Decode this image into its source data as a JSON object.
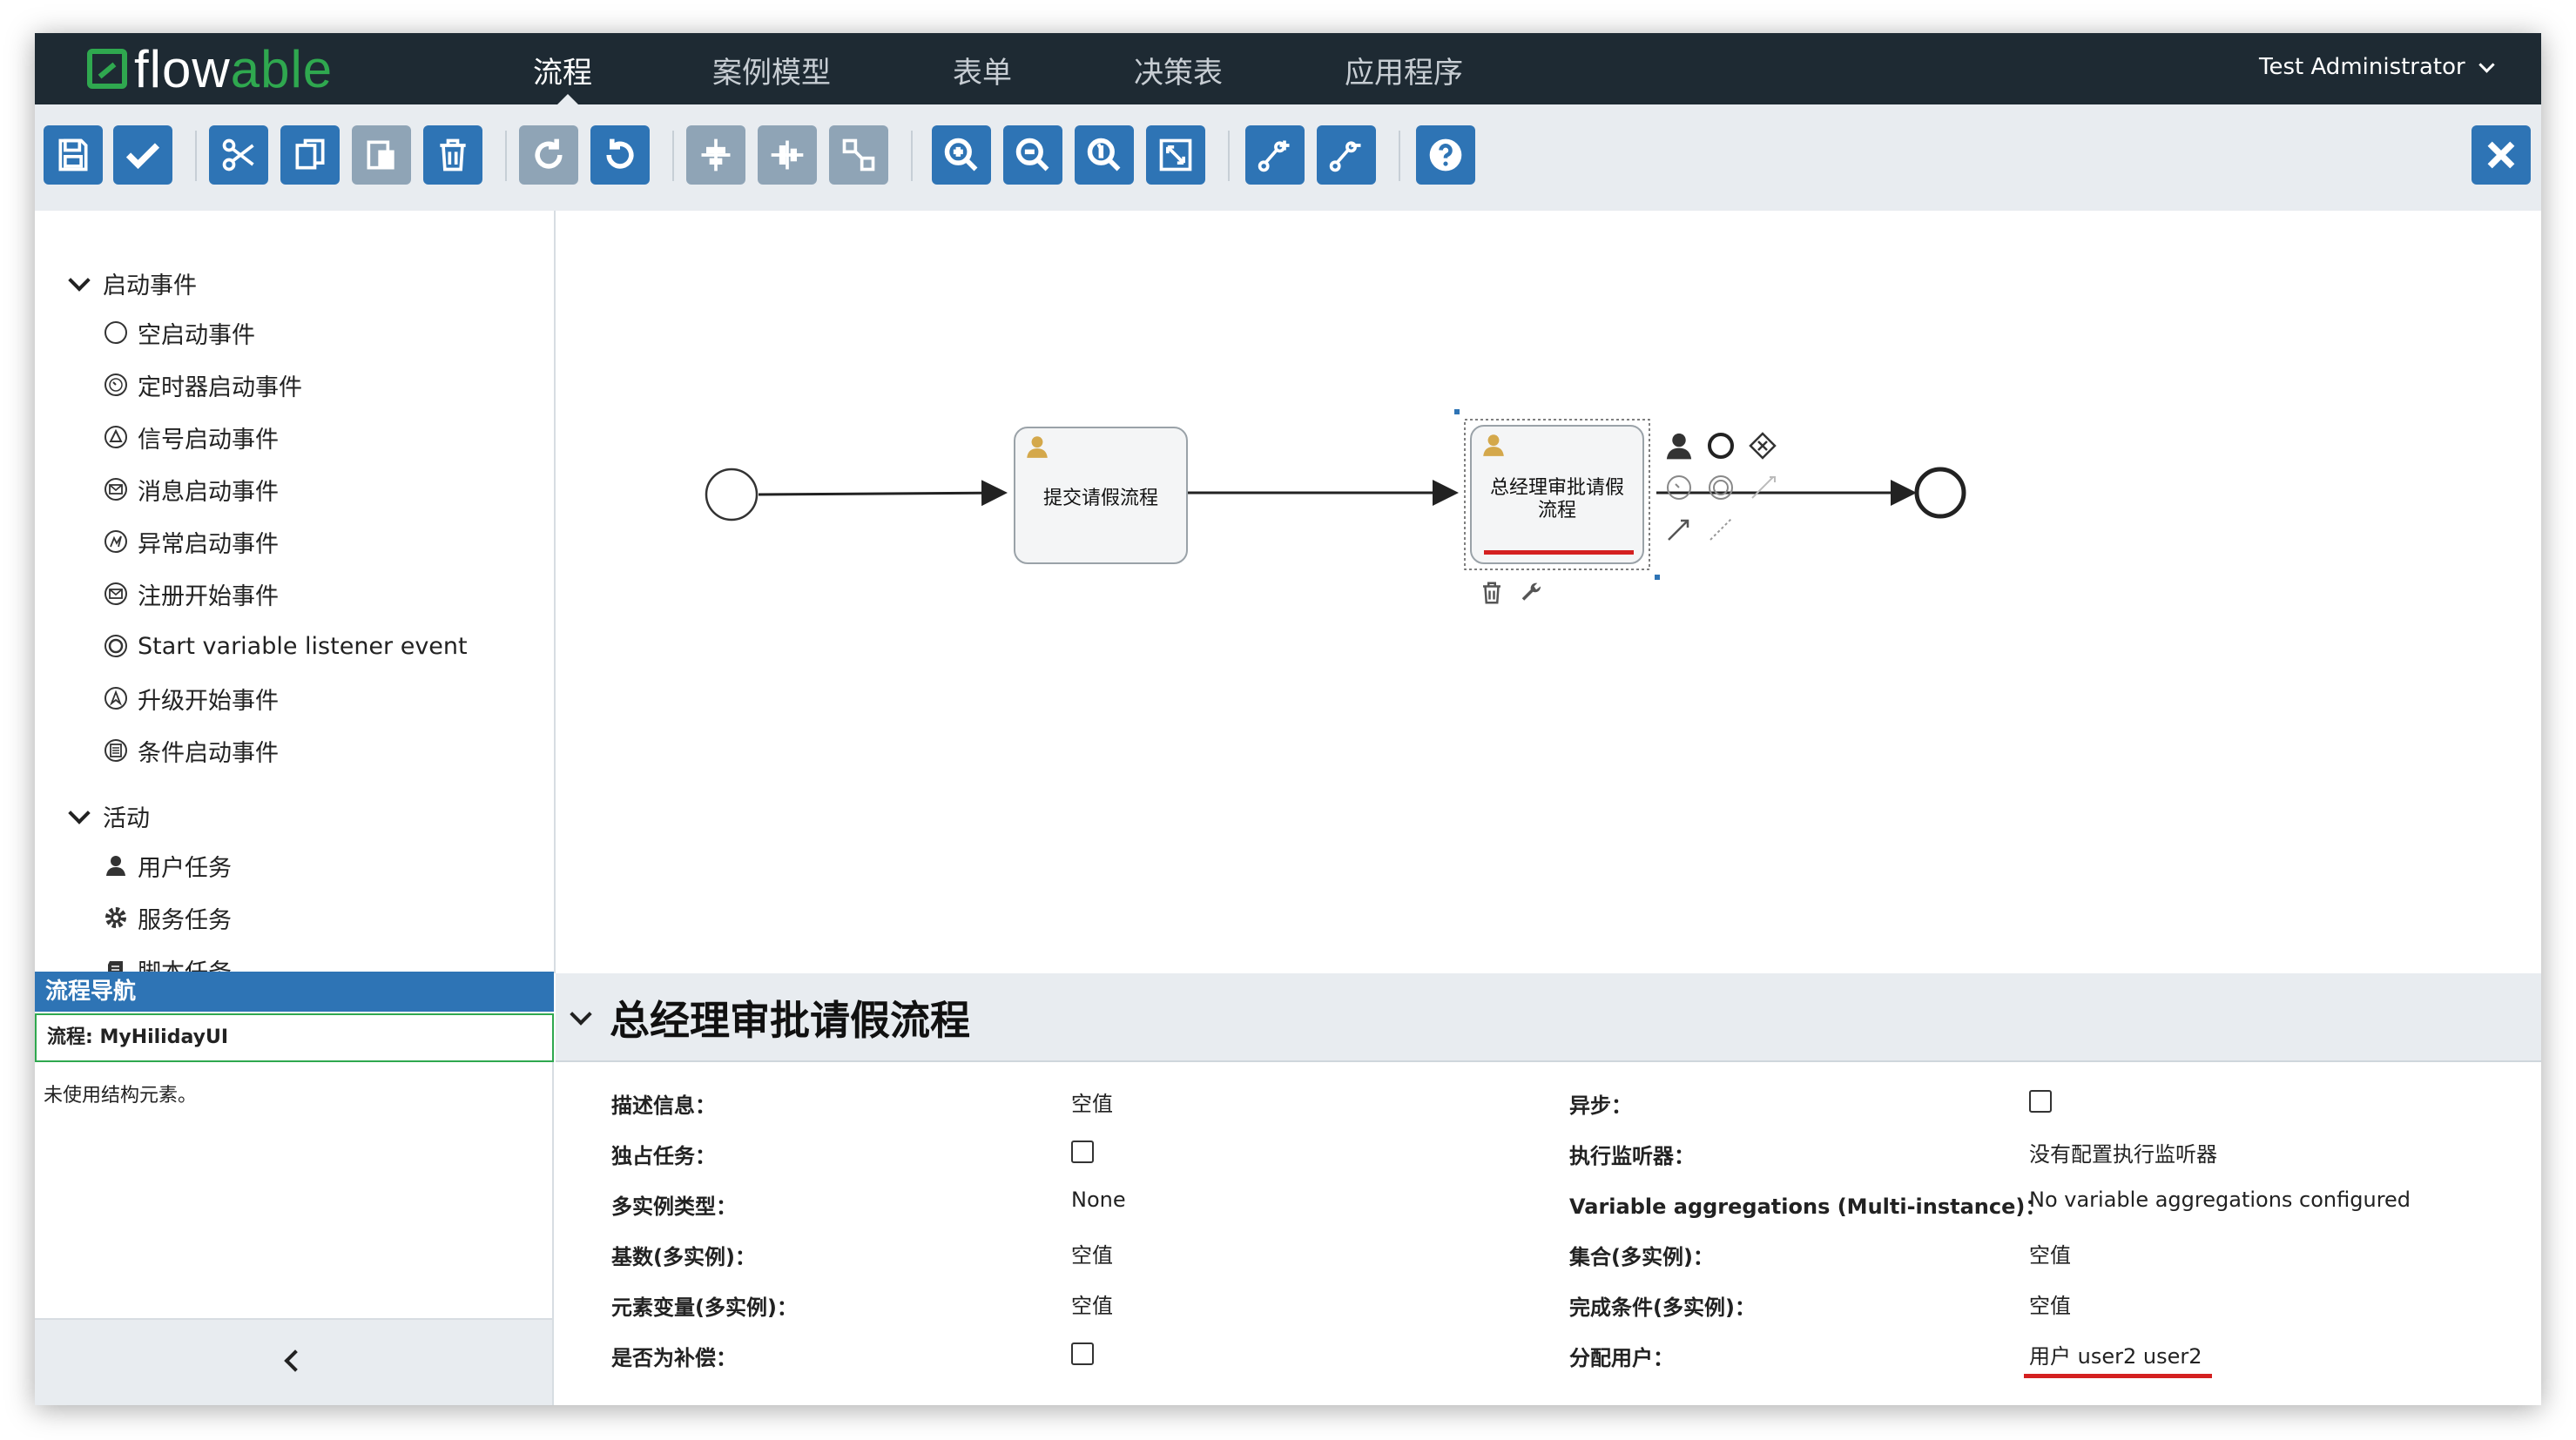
{
  "nav": {
    "logo": "flowable",
    "items": [
      "流程",
      "案例模型",
      "表单",
      "决策表",
      "应用程序"
    ],
    "active_index": 0,
    "user": "Test Administrator"
  },
  "toolbar": {
    "buttons": [
      "save-icon",
      "check-icon",
      "cut-icon",
      "copy-icon",
      "paste-icon",
      "delete-icon",
      "redo-icon",
      "undo-icon",
      "align-horizontal-icon",
      "align-vertical-icon",
      "same-size-icon",
      "zoom-in-icon",
      "zoom-out-icon",
      "zoom-actual-icon",
      "zoom-fit-icon",
      "bendpoint-add-icon",
      "bendpoint-remove-icon",
      "help-icon",
      "close-icon"
    ]
  },
  "palette": {
    "groups": [
      {
        "label": "启动事件",
        "items": [
          "空启动事件",
          "定时器启动事件",
          "信号启动事件",
          "消息启动事件",
          "异常启动事件",
          "注册开始事件",
          "Start variable listener event",
          "升级开始事件",
          "条件启动事件"
        ]
      },
      {
        "label": "活动",
        "items": [
          "用户任务",
          "服务任务",
          "脚本任务"
        ]
      }
    ]
  },
  "navigator": {
    "title": "流程导航",
    "process": "流程: MyHilidayUI",
    "empty": "未使用结构元素。"
  },
  "diagram": {
    "task1": "提交请假流程",
    "task2_line1": "总经理审批请假",
    "task2_line2": "流程"
  },
  "properties": {
    "title": "总经理审批请假流程",
    "rows": [
      {
        "label": "描述信息：",
        "value": "空值",
        "label2": "异步：",
        "value2": ""
      },
      {
        "label": "独占任务：",
        "value": "",
        "label2": "执行监听器：",
        "value2": "没有配置执行监听器"
      },
      {
        "label": "多实例类型：",
        "value": "None",
        "label2": "Variable aggregations (Multi-instance)：",
        "value2": "No variable aggregations configured"
      },
      {
        "label": "基数(多实例)：",
        "value": "空值",
        "label2": "集合(多实例)：",
        "value2": "空值"
      },
      {
        "label": "元素变量(多实例)：",
        "value": "空值",
        "label2": "完成条件(多实例)：",
        "value2": "空值"
      },
      {
        "label": "是否为补偿：",
        "value": "",
        "label2": "分配用户：",
        "value2": "用户 user2 user2"
      }
    ]
  }
}
